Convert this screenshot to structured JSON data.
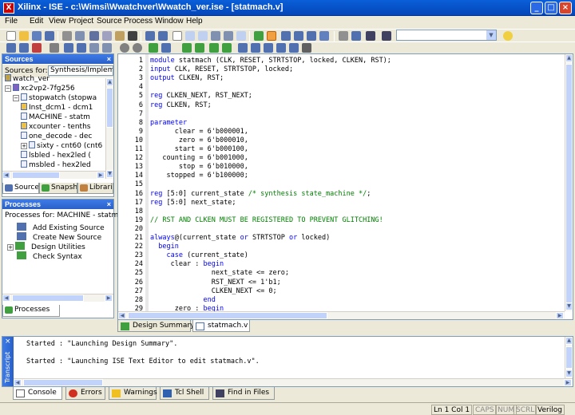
{
  "window": {
    "title": "Xilinx - ISE - c:\\Wimsi\\Wwatchver\\Wwatch_ver.ise - [statmach.v]",
    "app_icon": "X",
    "buttons": {
      "minimize": "_",
      "maximize": "□",
      "close": "×"
    }
  },
  "menu": {
    "items": [
      "File",
      "Edit",
      "View",
      "Project",
      "Source",
      "Process",
      "Window",
      "Help"
    ]
  },
  "toolbar": {
    "combo_value": "",
    "combo_arrow": "▼"
  },
  "sources_panel": {
    "title": "Sources",
    "close": "×",
    "sources_for_label": "Sources for:",
    "sources_for_value": "Synthesis/Implemen",
    "tree": [
      {
        "label": "watch_ver",
        "indent": 0,
        "icon": "project-icon",
        "expander": ""
      },
      {
        "label": "xc2vp2-7fg256",
        "indent": 0,
        "icon": "device-icon",
        "expander": "−"
      },
      {
        "label": "stopwatch (stopwa",
        "indent": 1,
        "icon": "verilog-file-icon",
        "expander": "−"
      },
      {
        "label": "Inst_dcm1 - dcm1",
        "indent": 2,
        "icon": "ip-core-icon",
        "expander": ""
      },
      {
        "label": "MACHINE - statm",
        "indent": 2,
        "icon": "verilog-file-icon",
        "expander": ""
      },
      {
        "label": "xcounter - tenths",
        "indent": 2,
        "icon": "ip-core-icon",
        "expander": ""
      },
      {
        "label": "one_decode - dec",
        "indent": 2,
        "icon": "verilog-file-icon",
        "expander": ""
      },
      {
        "label": "sixty - cnt60 (cnt6",
        "indent": 2,
        "icon": "verilog-file-icon",
        "expander": "+"
      },
      {
        "label": "lsbled - hex2led (",
        "indent": 2,
        "icon": "verilog-file-icon",
        "expander": ""
      },
      {
        "label": "msbled - hex2led",
        "indent": 2,
        "icon": "verilog-file-icon",
        "expander": ""
      }
    ],
    "tabs": [
      "Source",
      "Snapshots",
      "Libraries"
    ]
  },
  "processes_panel": {
    "title": "Processes",
    "close": "×",
    "processes_for": "Processes for: MACHINE - statma",
    "items": [
      {
        "label": "Add Existing Source",
        "expander": ""
      },
      {
        "label": "Create New Source",
        "expander": ""
      },
      {
        "label": "Design Utilities",
        "expander": "+"
      },
      {
        "label": "Check Syntax",
        "expander": ""
      }
    ],
    "tab": "Processes"
  },
  "editor": {
    "lines": [
      {
        "n": "1",
        "parts": [
          [
            "kw",
            "module"
          ],
          [
            "",
            "statmach (CLK, RESET, STRTSTOP, locked, CLKEN, RST);"
          ]
        ]
      },
      {
        "n": "2",
        "parts": [
          [
            "kw",
            "input"
          ],
          [
            "",
            "CLK, RESET, STRTSTOP, locked;"
          ]
        ]
      },
      {
        "n": "3",
        "parts": [
          [
            "kw",
            "output"
          ],
          [
            "",
            "CLKEN, RST;"
          ]
        ]
      },
      {
        "n": "4",
        "parts": []
      },
      {
        "n": "5",
        "parts": [
          [
            "kw",
            "reg"
          ],
          [
            "",
            "CLKEN_NEXT, RST_NEXT;"
          ]
        ]
      },
      {
        "n": "6",
        "parts": [
          [
            "kw",
            "reg"
          ],
          [
            "",
            "CLKEN, RST;"
          ]
        ]
      },
      {
        "n": "7",
        "parts": []
      },
      {
        "n": "8",
        "parts": [
          [
            "kw",
            "parameter"
          ]
        ]
      },
      {
        "n": "9",
        "parts": [
          [
            "",
            "      clear = 6'b000001,"
          ]
        ]
      },
      {
        "n": "10",
        "parts": [
          [
            "",
            "       zero = 6'b000010,"
          ]
        ]
      },
      {
        "n": "11",
        "parts": [
          [
            "",
            "      start = 6'b000100,"
          ]
        ]
      },
      {
        "n": "12",
        "parts": [
          [
            "",
            "   counting = 6'b001000,"
          ]
        ]
      },
      {
        "n": "13",
        "parts": [
          [
            "",
            "       stop = 6'b010000,"
          ]
        ]
      },
      {
        "n": "14",
        "parts": [
          [
            "",
            "    stopped = 6'b100000;"
          ]
        ]
      },
      {
        "n": "15",
        "parts": []
      },
      {
        "n": "16",
        "parts": [
          [
            "kw",
            "reg"
          ],
          [
            "",
            "[5:0] current_state "
          ],
          [
            "cm",
            "/* synthesis state_machine */"
          ],
          [
            "",
            ";"
          ]
        ]
      },
      {
        "n": "17",
        "parts": [
          [
            "kw",
            "reg"
          ],
          [
            "",
            "[5:0] next_state;"
          ]
        ]
      },
      {
        "n": "18",
        "parts": []
      },
      {
        "n": "19",
        "parts": [
          [
            "cm",
            "// RST AND CLKEN MUST BE REGISTERED TO PREVENT GLITCHING!"
          ]
        ]
      },
      {
        "n": "20",
        "parts": []
      },
      {
        "n": "21",
        "parts": [
          [
            "kw",
            "always"
          ],
          [
            "",
            "@(current_state "
          ],
          [
            "kw",
            "or"
          ],
          [
            "",
            "STRTSTOP "
          ],
          [
            "kw",
            "or"
          ],
          [
            "",
            "locked)"
          ]
        ]
      },
      {
        "n": "22",
        "parts": [
          [
            "",
            "  "
          ],
          [
            "kw",
            "begin"
          ]
        ]
      },
      {
        "n": "23",
        "parts": [
          [
            "",
            "    "
          ],
          [
            "kw",
            "case"
          ],
          [
            "",
            "(current_state)"
          ]
        ]
      },
      {
        "n": "24",
        "parts": [
          [
            "",
            "     clear : "
          ],
          [
            "kw",
            "begin"
          ]
        ]
      },
      {
        "n": "25",
        "parts": [
          [
            "",
            "               next_state <= zero;"
          ]
        ]
      },
      {
        "n": "26",
        "parts": [
          [
            "",
            "               RST_NEXT <= 1'b1;"
          ]
        ]
      },
      {
        "n": "27",
        "parts": [
          [
            "",
            "               CLKEN_NEXT <= 0;"
          ]
        ]
      },
      {
        "n": "28",
        "parts": [
          [
            "",
            "             "
          ],
          [
            "kw",
            "end"
          ]
        ]
      },
      {
        "n": "29",
        "parts": [
          [
            "",
            "      zero : "
          ],
          [
            "kw",
            "begin"
          ]
        ]
      }
    ],
    "tabs": [
      "Design Summary",
      "statmach.v"
    ]
  },
  "transcript": {
    "side_label": "Transcript",
    "close": "×",
    "lines": [
      "Started : \"Launching Design Summary\".",
      "Started : \"Launching ISE Text Editor to edit statmach.v\"."
    ],
    "tabs": [
      "Console",
      "Errors",
      "Warnings",
      "Tcl Shell",
      "Find in Files"
    ]
  },
  "statusbar": {
    "cells": [
      "Ln 1 Col 1",
      "CAPS",
      "NUM",
      "SCRL",
      "Verilog"
    ]
  },
  "colors": {
    "keyword": "#0000ff",
    "comment": "#008000",
    "titlebar": "#0a5fd8",
    "panel_header": "#3e7be8"
  }
}
